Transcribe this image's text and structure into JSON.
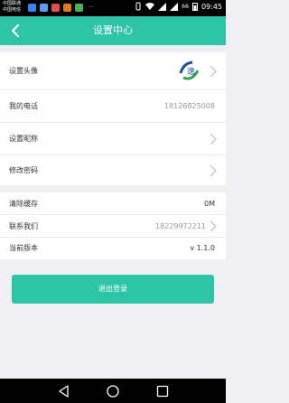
{
  "status_bar": {
    "carrier_line1": "中国联通",
    "carrier_line2": "中国电信",
    "battery": "66",
    "time": "09:45",
    "app_icon_colors": [
      "#3b82f6",
      "#5b9bf0",
      "#e34d4d",
      "#e27a1f",
      "#4caf50",
      "#999999"
    ]
  },
  "header": {
    "title": "设置中心",
    "back_icon": "chevron-left-icon"
  },
  "settings_group_1": [
    {
      "label": "设置头像",
      "type": "avatar",
      "has_chevron": true
    },
    {
      "label": "我的电话",
      "value": "18126825008",
      "has_chevron": false
    },
    {
      "label": "设置昵称",
      "has_chevron": true
    },
    {
      "label": "修改密码",
      "has_chevron": true
    }
  ],
  "settings_group_2": [
    {
      "label": "清除缓存",
      "value": "0M",
      "has_chevron": false
    },
    {
      "label": "联系我们",
      "value": "18229972211",
      "has_chevron": true
    },
    {
      "label": "当前版本",
      "value": "v 1.1.0",
      "has_chevron": false
    }
  ],
  "logout_button": "退出登录",
  "nav_bar": [
    "back-triangle-icon",
    "home-circle-icon",
    "recent-square-icon"
  ],
  "colors": {
    "accent": "#2ec5a7",
    "background": "#efeff4"
  }
}
